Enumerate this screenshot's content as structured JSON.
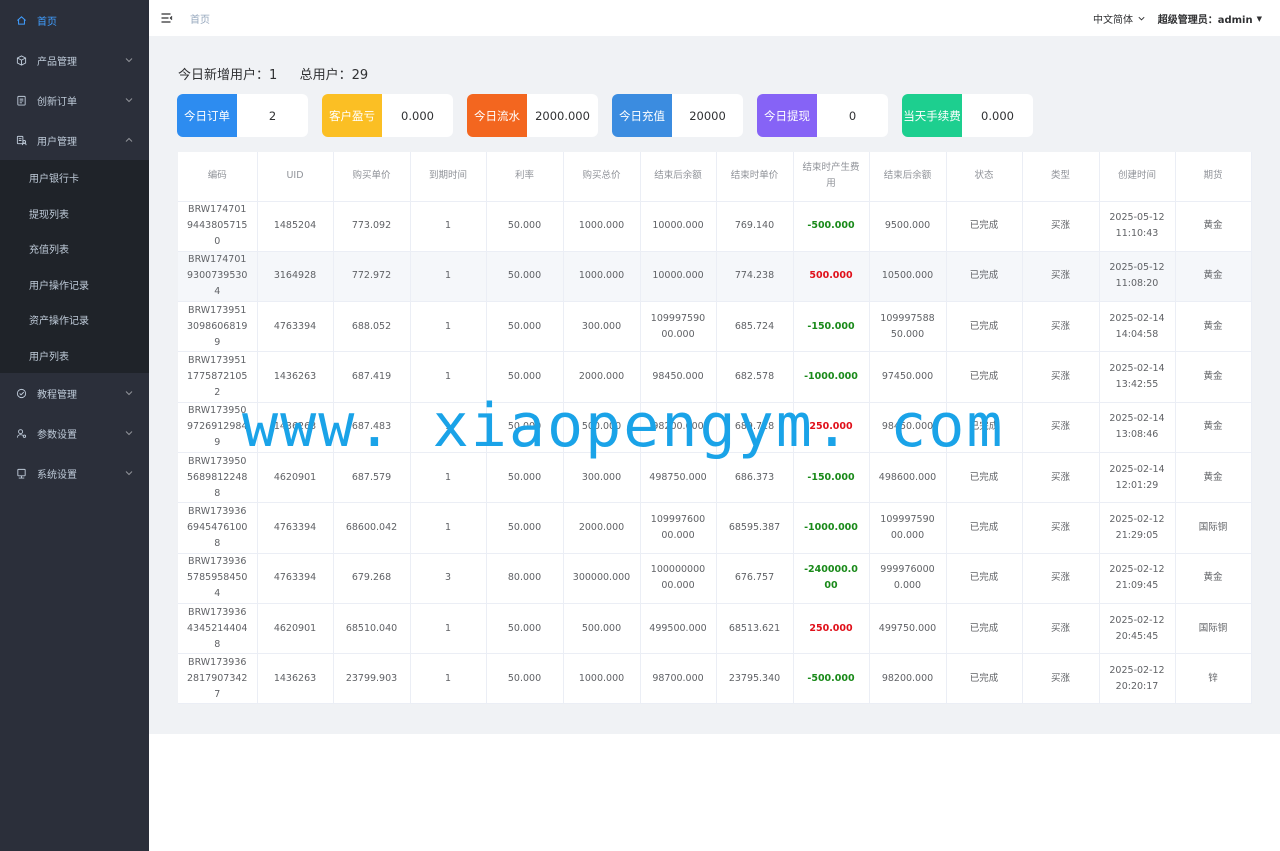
{
  "sidebar": {
    "home": "首页",
    "menus": [
      {
        "label": "产品管理",
        "icon": "box-icon"
      },
      {
        "label": "创新订单",
        "icon": "clipboard-icon"
      },
      {
        "label": "用户管理",
        "icon": "users-icon"
      }
    ],
    "user_submenu": [
      "用户银行卡",
      "提现列表",
      "充值列表",
      "用户操作记录",
      "资产操作记录",
      "用户列表"
    ],
    "menus_after": [
      {
        "label": "教程管理",
        "icon": "check-circle-icon"
      },
      {
        "label": "参数设置",
        "icon": "user-settings-icon"
      },
      {
        "label": "系统设置",
        "icon": "monitor-icon"
      }
    ]
  },
  "topbar": {
    "breadcrumb": "首页",
    "language": "中文简体",
    "user": "超级管理员：admin"
  },
  "summary": {
    "new_users_label": "今日新增用户：",
    "new_users": "1",
    "total_users_label": "总用户：",
    "total_users": "29"
  },
  "cards": [
    {
      "label": "今日订单",
      "value": "2",
      "color": "#2d8cf0"
    },
    {
      "label": "客户盈亏",
      "value": "0.000",
      "color": "#fbbf24"
    },
    {
      "label": "今日流水",
      "value": "2000.000",
      "color": "#f3661f"
    },
    {
      "label": "今日充值",
      "value": "20000",
      "color": "#3b8ce0"
    },
    {
      "label": "今日提现",
      "value": "0",
      "color": "#8663f6"
    },
    {
      "label": "当天手续费",
      "value": "0.000",
      "color": "#1dcf8f"
    }
  ],
  "table": {
    "headers": [
      "编码",
      "UID",
      "购买单价",
      "到期时间",
      "利率",
      "购买总价",
      "结束后余额",
      "结束时单价",
      "结束时产生费用",
      "结束后余额",
      "状态",
      "类型",
      "创建时间",
      "期货"
    ],
    "rows": [
      [
        "BRW17470194438057150",
        "1485204",
        "773.092",
        "1",
        "50.000",
        "1000.000",
        "10000.000",
        "769.140",
        "-500.000",
        "9500.000",
        "已完成",
        "买涨",
        "2025-05-12 11:10:43",
        "黄金"
      ],
      [
        "BRW17470193007395304",
        "3164928",
        "772.972",
        "1",
        "50.000",
        "1000.000",
        "10000.000",
        "774.238",
        "500.000",
        "10500.000",
        "已完成",
        "买涨",
        "2025-05-12 11:08:20",
        "黄金"
      ],
      [
        "BRW17395130986068199",
        "4763394",
        "688.052",
        "1",
        "50.000",
        "300.000",
        "10999759000.000",
        "685.724",
        "-150.000",
        "10999758850.000",
        "已完成",
        "买涨",
        "2025-02-14 14:04:58",
        "黄金"
      ],
      [
        "BRW17395117758721052",
        "1436263",
        "687.419",
        "1",
        "50.000",
        "2000.000",
        "98450.000",
        "682.578",
        "-1000.000",
        "97450.000",
        "已完成",
        "买涨",
        "2025-02-14 13:42:55",
        "黄金"
      ],
      [
        "BRW17395097269129849",
        "1436263",
        "687.483",
        "1",
        "50.000",
        "500.000",
        "98200.000",
        "689.718",
        "250.000",
        "98450.000",
        "已完成",
        "买涨",
        "2025-02-14 13:08:46",
        "黄金"
      ],
      [
        "BRW17395056898122488",
        "4620901",
        "687.579",
        "1",
        "50.000",
        "300.000",
        "498750.000",
        "686.373",
        "-150.000",
        "498600.000",
        "已完成",
        "买涨",
        "2025-02-14 12:01:29",
        "黄金"
      ],
      [
        "BRW17393669454761008",
        "4763394",
        "68600.042",
        "1",
        "50.000",
        "2000.000",
        "10999760000.000",
        "68595.387",
        "-1000.000",
        "10999759000.000",
        "已完成",
        "买涨",
        "2025-02-12 21:29:05",
        "国际铜"
      ],
      [
        "BRW17393657859584504",
        "4763394",
        "679.268",
        "3",
        "80.000",
        "300000.000",
        "10000000000.000",
        "676.757",
        "-240000.000",
        "9999760000.000",
        "已完成",
        "买涨",
        "2025-02-12 21:09:45",
        "黄金"
      ],
      [
        "BRW17393643452144048",
        "4620901",
        "68510.040",
        "1",
        "50.000",
        "500.000",
        "499500.000",
        "68513.621",
        "250.000",
        "499750.000",
        "已完成",
        "买涨",
        "2025-02-12 20:45:45",
        "国际铜"
      ],
      [
        "BRW17393628179073427",
        "1436263",
        "23799.903",
        "1",
        "50.000",
        "1000.000",
        "98700.000",
        "23795.340",
        "-500.000",
        "98200.000",
        "已完成",
        "买涨",
        "2025-02-12 20:20:17",
        "锌"
      ]
    ]
  },
  "watermark": "www. xiaopengym. com",
  "colors": {
    "sidebar_bg": "#2b2f3a",
    "submenu_bg": "#1f2329",
    "accent": "#409eff",
    "positive": "#1a8a1a",
    "negative": "#e0101a"
  }
}
